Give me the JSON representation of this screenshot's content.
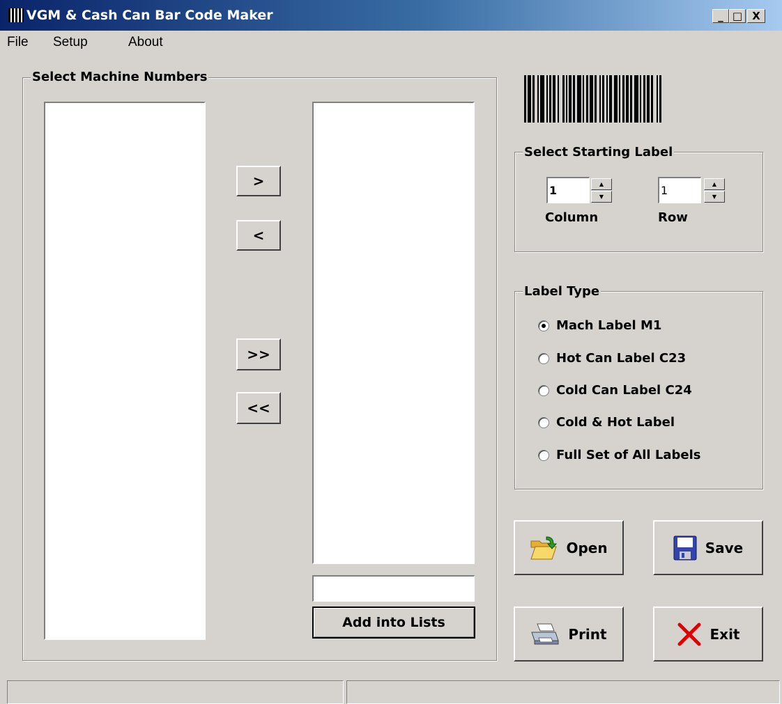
{
  "window": {
    "title": "VGM & Cash Can Bar Code Maker",
    "minimize_label": "_",
    "maximize_label": "□",
    "close_label": "X"
  },
  "menu": {
    "items": [
      "File",
      "Setup",
      "About"
    ]
  },
  "machine_group": {
    "title": "Select Machine Numbers",
    "move_right_label": ">",
    "move_left_label": "<",
    "move_all_right_label": ">>",
    "move_all_left_label": "<<",
    "new_entry_value": "",
    "add_button_label": "Add into Lists"
  },
  "starting_label": {
    "title": "Select Starting Label",
    "column_value": "1",
    "row_value": "1",
    "column_caption": "Column",
    "row_caption": "Row"
  },
  "label_type": {
    "title": "Label Type",
    "options": [
      {
        "label": "Mach Label M1",
        "selected": true
      },
      {
        "label": "Hot Can Label C23",
        "selected": false
      },
      {
        "label": "Cold Can Label C24",
        "selected": false
      },
      {
        "label": "Cold & Hot Label",
        "selected": false
      },
      {
        "label": "Full Set of All Labels",
        "selected": false
      }
    ]
  },
  "actions": {
    "open_label": "Open",
    "save_label": "Save",
    "print_label": "Print",
    "exit_label": "Exit"
  },
  "colors": {
    "titlebar_start": "#0a246a",
    "titlebar_end": "#a6caf0",
    "window_bg": "#d6d3ce",
    "exit_icon": "#e00000",
    "save_icon": "#3344aa",
    "open_icon": "#f0c040"
  },
  "icons": {
    "app": "barcode-icon",
    "open": "folder-open-icon",
    "save": "floppy-disk-icon",
    "print": "printer-icon",
    "exit": "red-x-icon"
  }
}
